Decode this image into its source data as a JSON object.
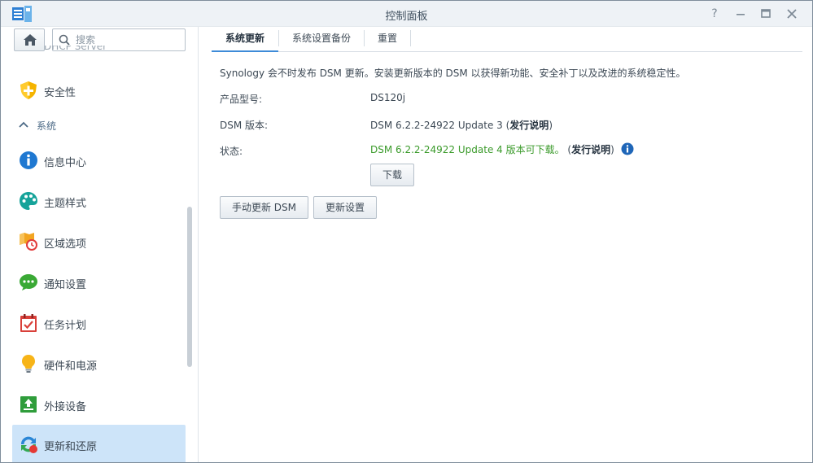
{
  "window": {
    "title": "控制面板",
    "controls": [
      "help-icon",
      "minimize-icon",
      "maximize-icon",
      "close-icon"
    ]
  },
  "sidebar": {
    "search_placeholder": "搜索",
    "partial_item_label": "DHCP Server",
    "items_before_section": [
      {
        "label": "安全性",
        "icon": "shield-icon"
      }
    ],
    "section": {
      "label": "系统",
      "icon": "chevron-up-icon"
    },
    "items": [
      {
        "label": "信息中心",
        "icon": "info-icon"
      },
      {
        "label": "主题样式",
        "icon": "palette-icon"
      },
      {
        "label": "区域选项",
        "icon": "regional-clock-icon"
      },
      {
        "label": "通知设置",
        "icon": "chat-bubble-icon"
      },
      {
        "label": "任务计划",
        "icon": "calendar-check-icon"
      },
      {
        "label": "硬件和电源",
        "icon": "lightbulb-icon"
      },
      {
        "label": "外接设备",
        "icon": "upload-device-icon"
      },
      {
        "label": "更新和还原",
        "icon": "update-restore-icon",
        "active": true
      }
    ],
    "accent_color": "#cde4f9"
  },
  "tabs": [
    {
      "label": "系统更新",
      "active": true
    },
    {
      "label": "系统设置备份",
      "active": false
    },
    {
      "label": "重置",
      "active": false
    }
  ],
  "content": {
    "intro": "Synology 会不时发布 DSM 更新。安装更新版本的 DSM 以获得新功能、安全补丁以及改进的系统稳定性。",
    "product_model_label": "产品型号:",
    "product_model_value": "DS120j",
    "dsm_version_label": "DSM 版本:",
    "dsm_version_value": "DSM 6.2.2-24922 Update 3",
    "release_notes_link": "发行说明",
    "status_label": "状态:",
    "status_value": "DSM 6.2.2-24922 Update 4 版本可下载。",
    "status_color": "#3a9a2a",
    "download_button": "下载",
    "manual_update_button": "手动更新 DSM",
    "update_settings_button": "更新设置"
  }
}
